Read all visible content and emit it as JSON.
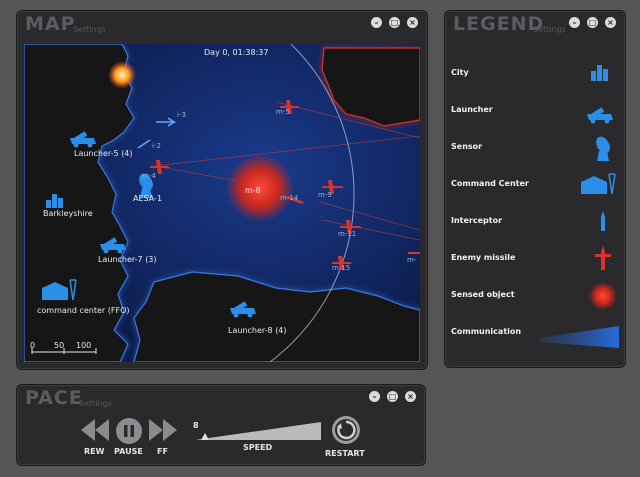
{
  "map_panel": {
    "title": "MAP",
    "settings": "Settings",
    "clock": "Day 0, 01:38:37",
    "units": [
      {
        "type": "launcher",
        "label": "Launcher-5 (4)"
      },
      {
        "type": "sensor",
        "label": "AESA-1"
      },
      {
        "type": "city",
        "label": "Barkleyshire"
      },
      {
        "type": "launcher",
        "label": "Launcher-7 (3)"
      },
      {
        "type": "command-center",
        "label": "command center (FFO)"
      },
      {
        "type": "launcher",
        "label": "Launcher-8 (4)"
      }
    ],
    "interceptors": [
      "i-3",
      "i-2"
    ],
    "missiles": [
      "m-5",
      "m-4",
      "m-8",
      "m-14",
      "m-9",
      "m-11",
      "m-15",
      "m-"
    ],
    "scale_labels": [
      "0",
      "50",
      "100"
    ]
  },
  "legend_panel": {
    "title": "LEGEND",
    "settings": "Settings",
    "items": [
      {
        "label": "City",
        "icon": "city-icon"
      },
      {
        "label": "Launcher",
        "icon": "launcher-icon"
      },
      {
        "label": "Sensor",
        "icon": "sensor-icon"
      },
      {
        "label": "Command Center",
        "icon": "command-center-icon"
      },
      {
        "label": "Interceptor",
        "icon": "interceptor-icon"
      },
      {
        "label": "Enemy missile",
        "icon": "enemy-missile-icon"
      },
      {
        "label": "Sensed object",
        "icon": "sensed-object-icon"
      },
      {
        "label": "Communication",
        "icon": "communication-icon"
      }
    ]
  },
  "pace_panel": {
    "title": "PACE",
    "settings": "Settings",
    "rew_label": "REW",
    "pause_label": "PAUSE",
    "ff_label": "FF",
    "speed_value": "8",
    "speed_label": "SPEED",
    "speed_fraction": 0.05,
    "restart_label": "RESTART"
  },
  "window_buttons": {
    "minimize": "–",
    "maximize": "□",
    "close": "×"
  },
  "colors": {
    "friendly": "#2b8ee8",
    "enemy": "#d8342c",
    "ocean": "#0c1e54",
    "land": "#141418"
  }
}
